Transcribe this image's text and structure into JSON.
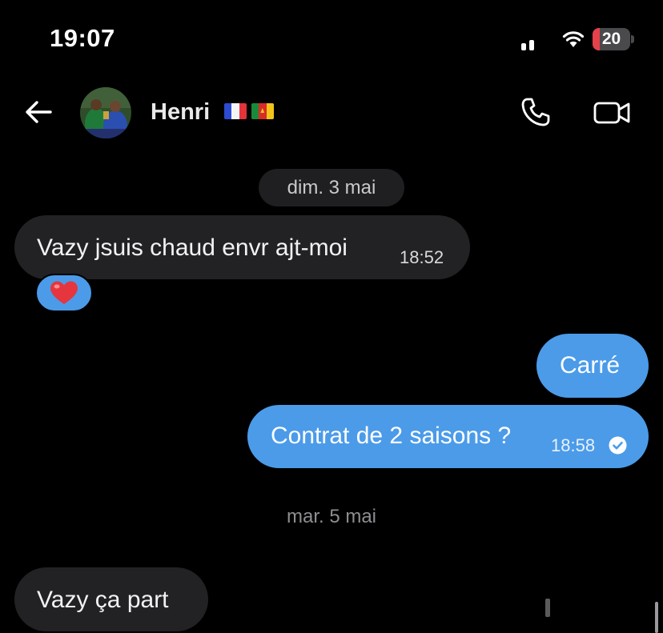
{
  "status_bar": {
    "time": "19:07",
    "battery_percent": "20",
    "battery_level": 0.2,
    "battery_color": "#e5414b"
  },
  "header": {
    "contact_name": "Henri",
    "flags": [
      "france-flag-icon",
      "cameroon-flag-icon"
    ],
    "icons": [
      "back-arrow-icon",
      "phone-icon",
      "video-call-icon"
    ]
  },
  "conversation": {
    "date_1": "dim. 3 mai",
    "message_1": {
      "text": "Vazy jsuis chaud envr ajt-moi",
      "time": "18:52",
      "reaction": "❤️"
    },
    "message_2": {
      "text": "Carré"
    },
    "message_3": {
      "text": "Contrat de 2 saisons ?",
      "time": "18:58",
      "status": "read"
    },
    "date_2": "mar. 5 mai",
    "message_4": {
      "text": "Vazy ça part"
    }
  },
  "colors": {
    "background": "#000000",
    "incoming_bubble": "#222224",
    "outgoing_bubble": "#4b9be9",
    "date_chip": "#1f1f21"
  }
}
